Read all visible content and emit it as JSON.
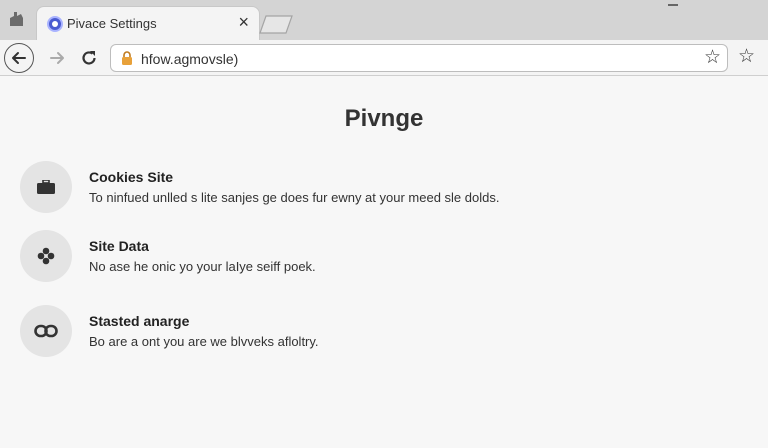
{
  "browser": {
    "tab_title": "Pivace Settings",
    "tab_close": "×",
    "url": "hfow.agmovsle)"
  },
  "page": {
    "heading": "Pivnge",
    "items": [
      {
        "title": "Cookies Site",
        "description": "To ninfued unlled s lite sanjes ge does fur ewny at your meed sle dolds.",
        "icon": "briefcase-icon"
      },
      {
        "title": "Site Data",
        "description": "No ase he onic yo your laIye seiff poek.",
        "icon": "flower-icon"
      },
      {
        "title": "Stasted anarge",
        "description": "Bo are a ont you are we blvveks afloltry.",
        "icon": "link-icon"
      }
    ]
  },
  "colors": {
    "tabstrip": "#d4d4d4",
    "toolbar": "#f4f4f4",
    "page_background": "#f7f7f7",
    "icon_circle": "#e4e4e4",
    "favicon": "#4a5bd1",
    "lock": "#e8a13a"
  }
}
